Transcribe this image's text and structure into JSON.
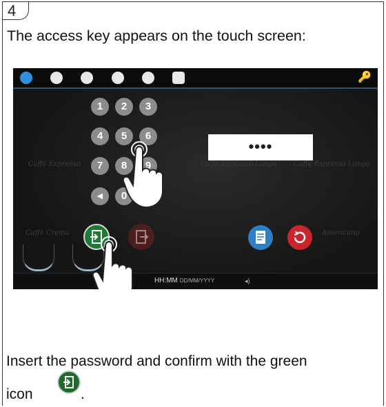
{
  "step": {
    "number": "4"
  },
  "caption_top": "The access key appears on the touch screen:",
  "screen": {
    "password_mask": "••••",
    "keypad": [
      "1",
      "2",
      "3",
      "4",
      "5",
      "6",
      "7",
      "8",
      "9",
      "◂",
      "0"
    ],
    "ghost_labels": [
      "Caffè Espresso",
      "Caffè Espresso Lungo",
      "Caffè Espresso Lungo",
      "Caffè Crema",
      "Americano"
    ],
    "status_time": "HH:MM",
    "status_date": "DD/MM/YYYY",
    "volume": "◂)"
  },
  "caption_bottom": "Insert the password and confirm with the green",
  "caption_icon_prefix": "icon",
  "caption_period": ".",
  "colors": {
    "confirm": "#1f7a34",
    "exit": "#5a2020",
    "document": "#2f7fc2",
    "record": "#c8262a"
  }
}
